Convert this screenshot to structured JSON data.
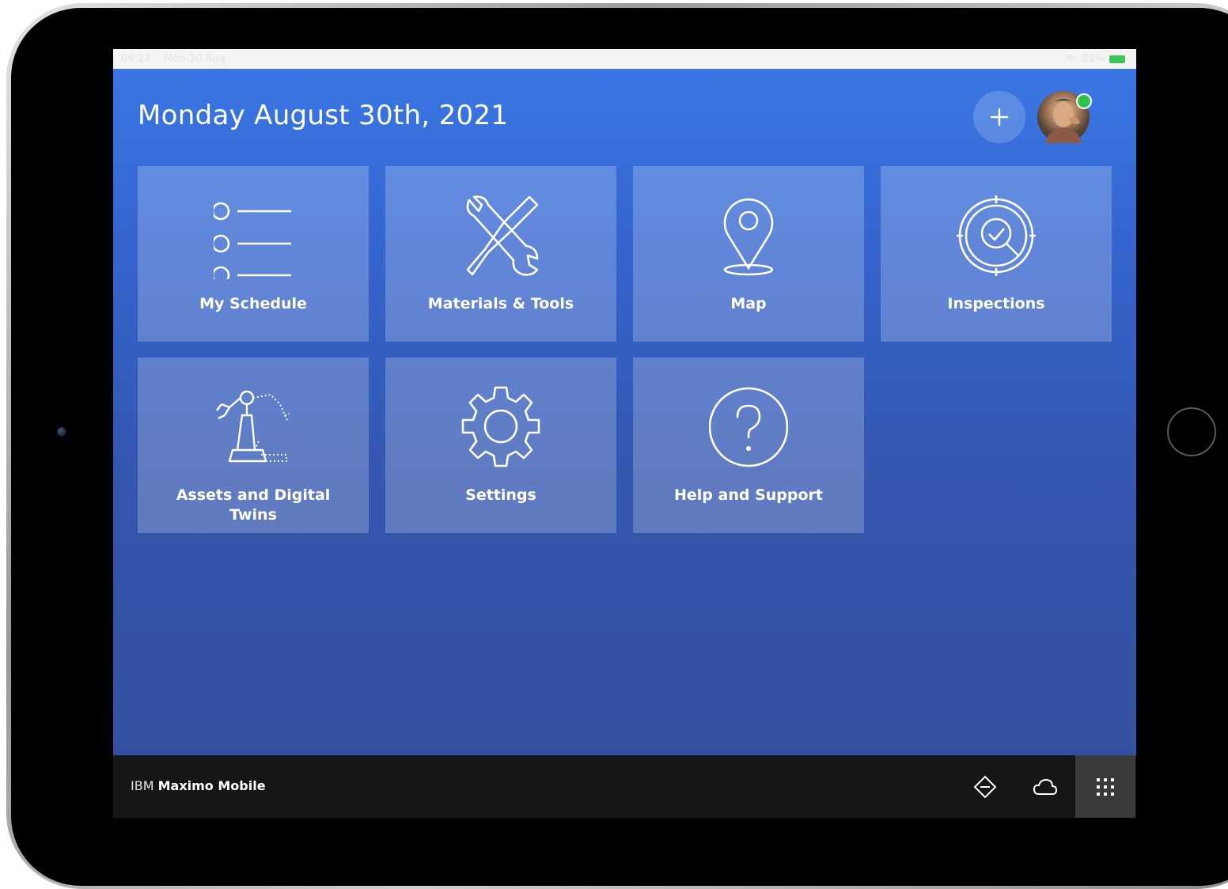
{
  "status_bar": {
    "time": "09:27",
    "date": "Mon 30 Aug",
    "battery": "81%"
  },
  "header": {
    "date_title": "Monday August 30th, 2021",
    "add_icon": "plus-icon",
    "avatar": "user-avatar"
  },
  "tiles": [
    {
      "label": "My Schedule",
      "icon": "list-icon"
    },
    {
      "label": "Materials & Tools",
      "icon": "wrench-screwdriver-icon"
    },
    {
      "label": "Map",
      "icon": "map-pin-icon"
    },
    {
      "label": "Inspections",
      "icon": "inspection-target-icon"
    },
    {
      "label": "Assets and Digital Twins",
      "icon": "robot-arm-icon"
    },
    {
      "label": "Settings",
      "icon": "gear-icon"
    },
    {
      "label": "Help and Support",
      "icon": "help-icon"
    }
  ],
  "footer": {
    "brand_prefix": "IBM",
    "brand_name": "Maximo Mobile",
    "actions": [
      "navigation-diamond-icon",
      "cloud-icon",
      "app-grid-icon"
    ]
  },
  "colors": {
    "accent_top": "#3a79e6",
    "accent_bottom": "#344f9e",
    "footer": "#161616",
    "status_online": "#2fc24a"
  }
}
